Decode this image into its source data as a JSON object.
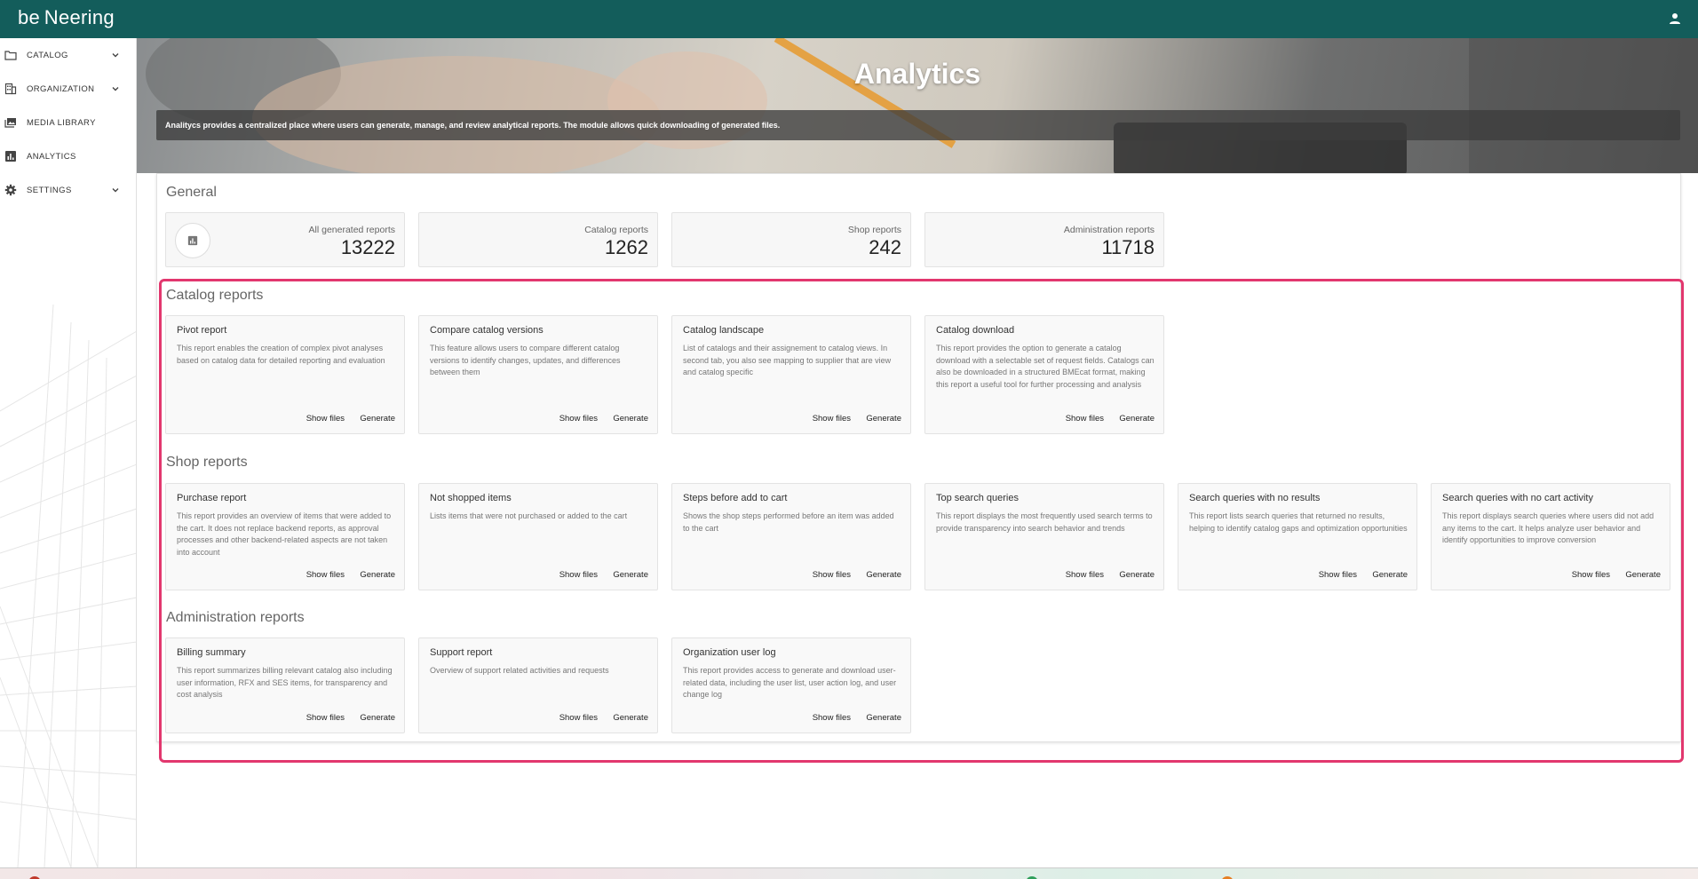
{
  "app": {
    "logo_text": "be Neering"
  },
  "sidebar": {
    "items": [
      {
        "label": "CATALOG",
        "icon": "folder-icon",
        "expandable": true
      },
      {
        "label": "ORGANIZATION",
        "icon": "building-icon",
        "expandable": true
      },
      {
        "label": "MEDIA LIBRARY",
        "icon": "media-library-icon",
        "expandable": false
      },
      {
        "label": "ANALYTICS",
        "icon": "analytics-icon",
        "expandable": false
      },
      {
        "label": "SETTINGS",
        "icon": "gear-icon",
        "expandable": true
      }
    ]
  },
  "hero": {
    "title": "Analytics",
    "description": "Analitycs provides a centralized place where users can generate, manage, and review analytical reports. The module allows quick downloading of generated files."
  },
  "general": {
    "title": "General",
    "stats": [
      {
        "label": "All generated reports",
        "value": "13222"
      },
      {
        "label": "Catalog reports",
        "value": "1262"
      },
      {
        "label": "Shop reports",
        "value": "242"
      },
      {
        "label": "Administration reports",
        "value": "11718"
      }
    ]
  },
  "buttons": {
    "show_files": "Show files",
    "generate": "Generate"
  },
  "catalog_reports": {
    "title": "Catalog reports",
    "cards": [
      {
        "title": "Pivot report",
        "desc": "This report enables the creation of complex pivot analyses based on catalog data for detailed reporting and evaluation"
      },
      {
        "title": "Compare catalog versions",
        "desc": "This feature allows users to compare different catalog versions to identify changes, updates, and differences between them"
      },
      {
        "title": "Catalog landscape",
        "desc": "List of catalogs and their assignement to catalog views. In second tab, you also see mapping to supplier that are view and catalog specific"
      },
      {
        "title": "Catalog download",
        "desc": "This report provides the option to generate a catalog download with a selectable set of request fields. Catalogs can also be downloaded in a structured BMEcat format, making this report a useful tool for further processing and analysis"
      }
    ]
  },
  "shop_reports": {
    "title": "Shop reports",
    "cards": [
      {
        "title": "Purchase report",
        "desc": "This report provides an overview of items that were added to the cart. It does not replace backend reports, as approval processes and other backend-related aspects are not taken into account"
      },
      {
        "title": "Not shopped items",
        "desc": "Lists items that were not purchased or added to the cart"
      },
      {
        "title": "Steps before add to cart",
        "desc": "Shows the shop steps performed before an item was added to the cart"
      },
      {
        "title": "Top search queries",
        "desc": "This report displays the most frequently used search terms to provide transparency into search behavior and trends"
      },
      {
        "title": "Search queries with no results",
        "desc": "This report lists search queries that returned no results, helping to identify catalog gaps and optimization opportunities"
      },
      {
        "title": "Search queries with no cart activity",
        "desc": "This report displays search queries where users did not add any items to the cart. It helps analyze user behavior and identify opportunities to improve conversion"
      }
    ]
  },
  "admin_reports": {
    "title": "Administration reports",
    "cards": [
      {
        "title": "Billing summary",
        "desc": "This report summarizes billing relevant catalog also including user information, RFX and SES items, for transparency and cost analysis"
      },
      {
        "title": "Support report",
        "desc": "Overview of support related activities and requests"
      },
      {
        "title": "Organization user log",
        "desc": "This report provides access to generate and download user-related data, including the user list, user action log, and user change log"
      }
    ]
  },
  "colors": {
    "topbar": "#135d5b",
    "highlight": "#e2376e"
  }
}
